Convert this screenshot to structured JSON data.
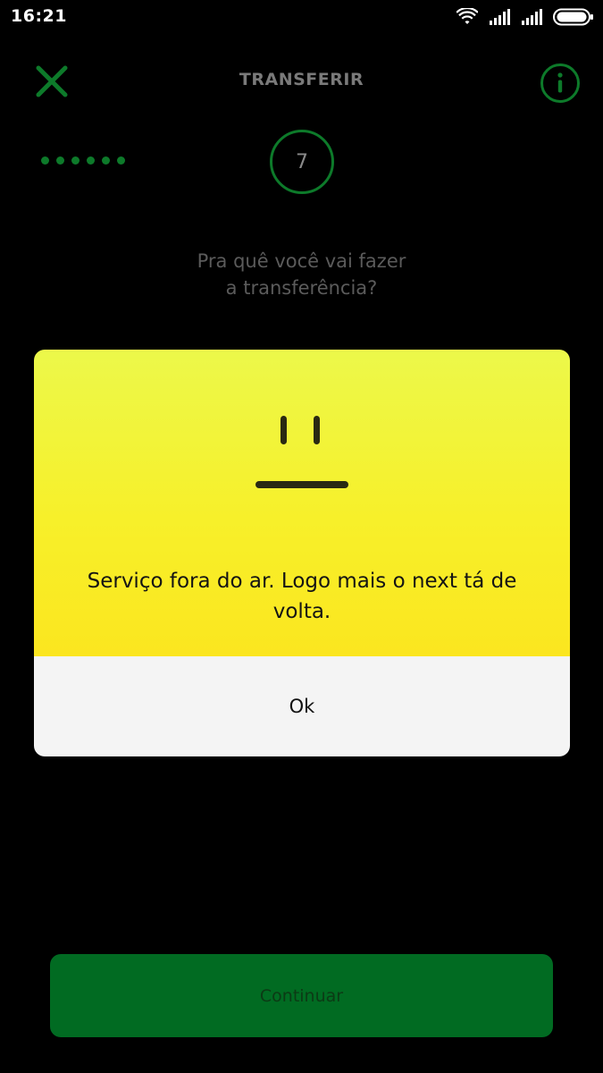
{
  "status_bar": {
    "time": "16:21",
    "icons": [
      "wifi-icon",
      "signal-icon",
      "signal-icon",
      "battery-icon"
    ]
  },
  "header": {
    "title": "TRANSFERIR",
    "close_icon": "close-icon",
    "info_icon": "info-icon"
  },
  "progress": {
    "completed_steps": 6,
    "current_step": "7"
  },
  "question": {
    "line1": "Pra quê você vai fazer",
    "line2": "a transferência?"
  },
  "dialog": {
    "icon": "neutral-face-icon",
    "message": "Serviço fora do ar. Logo mais o next tá de volta.",
    "ok_label": "Ok"
  },
  "footer": {
    "continue_label": "Continuar"
  },
  "colors": {
    "background": "#000000",
    "accent_green": "#0d7a2a",
    "button_green": "#016b22",
    "dialog_yellow_top": "#ecf84a",
    "dialog_yellow_bottom": "#fbe61f",
    "dialog_footer": "#f4f4f4"
  }
}
